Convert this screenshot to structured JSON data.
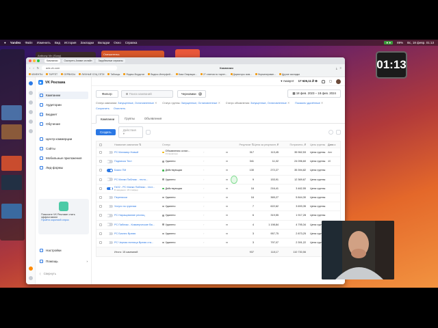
{
  "menubar": {
    "app": "Yandex",
    "items": [
      "Файл",
      "Изменить",
      "Вид",
      "История",
      "Закладки",
      "Вкладки",
      "Окно",
      "Справка"
    ],
    "battery": "89%",
    "datetime": "Вс, 18 февр. 01:13"
  },
  "bg_windows": {
    "left_title": "Anthony Vin (Sony)",
    "center_title": "Смешательь"
  },
  "timer": "01:13",
  "browser": {
    "tabs": [
      {
        "label": "Кампании",
        "active": true
      },
      {
        "label": "Смотреть Аниме онлайн",
        "active": false
      },
      {
        "label": "Зарубежные сериалы",
        "active": false
      }
    ],
    "url": "ads.vk.com",
    "page_title": "Кампании",
    "bookmarks": [
      "КЛИЕНТЫ",
      "ТАРГЕТ",
      "СЕРВИСЫ",
      "ЛИЧНЫЕ СОЦ СЕТИ",
      "Таблицы",
      "Яндекс.Вордстат",
      "Видеос.Интерфей...",
      "База Опирации...",
      "27 ответов по таргет...",
      "Директоры смм...",
      "Форматирован...",
      "Другие закладки"
    ]
  },
  "app": {
    "logo": "VK Реклама",
    "nav": [
      {
        "label": "Кампании",
        "icon": "campaigns-icon",
        "active": true
      },
      {
        "label": "Аудитории",
        "icon": "audiences-icon",
        "active": false
      },
      {
        "label": "Бюджет",
        "icon": "budget-icon",
        "active": false
      },
      {
        "label": "Обучение",
        "icon": "learning-icon",
        "active": false
      },
      {
        "label": "Центр коммерции",
        "icon": "commerce-icon",
        "active": false
      },
      {
        "label": "Сайты",
        "icon": "sites-icon",
        "active": false
      },
      {
        "label": "Мобильные приложения",
        "icon": "apps-icon",
        "active": false
      },
      {
        "label": "Лид-формы",
        "icon": "leadforms-icon",
        "active": false
      }
    ],
    "promo": {
      "text": "Помогите VK Рекламе стать эффективнее",
      "link": "Пройти короткий опрос"
    },
    "bottom": {
      "settings": "Настройки",
      "help": "Помощь",
      "collapse": "Свернуть"
    },
    "topbar": {
      "account": "Аккаунт",
      "balance": "17 626,11 ₽"
    },
    "filter": {
      "filter_btn": "Фильтр",
      "search_placeholder": "Поиск кампаний",
      "drafts": "Черновики",
      "drafts_count": "0",
      "date_range": "18 фев. 2023 – 18 фев. 2024"
    },
    "statuses": [
      {
        "label": "Статус кампании:",
        "value": "Запущенные, Остановленные"
      },
      {
        "label": "Статус группы:",
        "value": "Запущенные, Остановленные"
      },
      {
        "label": "Статус объявления:",
        "value": "Запущенные, Остановленные"
      },
      {
        "label": "",
        "value": "Показать удалённые"
      }
    ],
    "save": "Сохранить",
    "clear": "Очистить",
    "tabs": [
      {
        "label": "Кампании",
        "active": true
      },
      {
        "label": "Группы",
        "active": false
      },
      {
        "label": "Объявления",
        "active": false
      }
    ],
    "toolbar": {
      "create": "Создать",
      "actions": "Действия"
    },
    "table": {
      "headers": {
        "name": "Название кампании ⇅",
        "status": "Статус",
        "spent": "Результат ⇅",
        "ppr": "Цена за результат, ₽",
        "spent2": "Потрачено, ₽",
        "goal": "Цель группы",
        "goaltype": "Дата с"
      },
      "rows": [
        {
          "on": false,
          "name": "РС Маникюр Новый",
          "sub": "",
          "status": "Объявления остан...",
          "status_sub": "Остановлено",
          "dot": "yellow",
          "result": "317",
          "ppr": "113,45",
          "spent2": "35 962,53",
          "goal": "Цена группы",
          "goaltype": "Авт"
        },
        {
          "on": false,
          "name": "Подписка Тест",
          "sub": "",
          "status": "Удалено",
          "status_sub": "",
          "dot": "grey",
          "result": "341",
          "ppr": "11,02",
          "spent2": "24 096,60",
          "goal": "Цена группы",
          "goaltype": "40"
        },
        {
          "on": true,
          "name": "Базис ПМ",
          "sub": "",
          "status": "Действующая",
          "status_sub": "",
          "dot": "green",
          "result": "130",
          "ppr": "272,27",
          "spent2": "35 394,82",
          "goal": "Цена группы",
          "goaltype": ""
        },
        {
          "on": false,
          "name": "РС Манки Пабликс - тесто...",
          "sub": "",
          "status": "Удалено",
          "status_sub": "",
          "dot": "grey",
          "result": "9",
          "ppr": "153,91",
          "spent2": "12 369,67",
          "goal": "Цена группы",
          "goaltype": ""
        },
        {
          "on": true,
          "name": "ГАЗ2 - РС Манки Пабликс - тест...",
          "sub": "В ожидании: 18 Слайдер",
          "status": "Действующая",
          "status_sub": "",
          "dot": "green",
          "result": "16",
          "ppr": "216,41",
          "spent2": "3 462,55",
          "goal": "Цена группы",
          "goaltype": ""
        },
        {
          "on": false,
          "name": "Переписки",
          "sub": "",
          "status": "Удалено",
          "status_sub": "",
          "dot": "grey",
          "result": "16",
          "ppr": "365,27",
          "spent2": "5 844,30",
          "goal": "Цена группы",
          "goaltype": ""
        },
        {
          "on": false,
          "name": "Услуги по группам",
          "sub": "",
          "status": "Удалено",
          "status_sub": "",
          "dot": "grey",
          "result": "7",
          "ppr": "622,62",
          "spent2": "3 693,35",
          "goal": "Цена группы",
          "goaltype": ""
        },
        {
          "on": false,
          "name": "РС Наращивание ресниц",
          "sub": "",
          "status": "Удалено",
          "status_sub": "",
          "dot": "grey",
          "result": "6",
          "ppr": "319,55",
          "spent2": "1 917,28",
          "goal": "Цена группы",
          "goaltype": ""
        },
        {
          "on": false,
          "name": "РС Пабликс - Коммерческие Ва...",
          "sub": "",
          "status": "Удалено",
          "status_sub": "",
          "dot": "grey",
          "result": "4",
          "ppr": "1 198,84",
          "spent2": "4 795,34",
          "goal": "Цена группы",
          "goaltype": ""
        },
        {
          "on": false,
          "name": "РС Бизнес Время",
          "sub": "",
          "status": "Удалено",
          "status_sub": "",
          "dot": "grey",
          "result": "3",
          "ppr": "957,75",
          "spent2": "2 873,25",
          "goal": "Цена группы",
          "goaltype": ""
        },
        {
          "on": false,
          "name": "РС Черная пятница Время ста...",
          "sub": "",
          "status": "Удалено",
          "status_sub": "",
          "dot": "grey",
          "result": "3",
          "ppr": "797,07",
          "spent2": "2 391,22",
          "goal": "Цена группы",
          "goaltype": ""
        }
      ],
      "footer": {
        "label": "Итого: 15 кампаний",
        "result": "937",
        "ppr": "118,17",
        "spent2": "110 730,56"
      }
    }
  }
}
